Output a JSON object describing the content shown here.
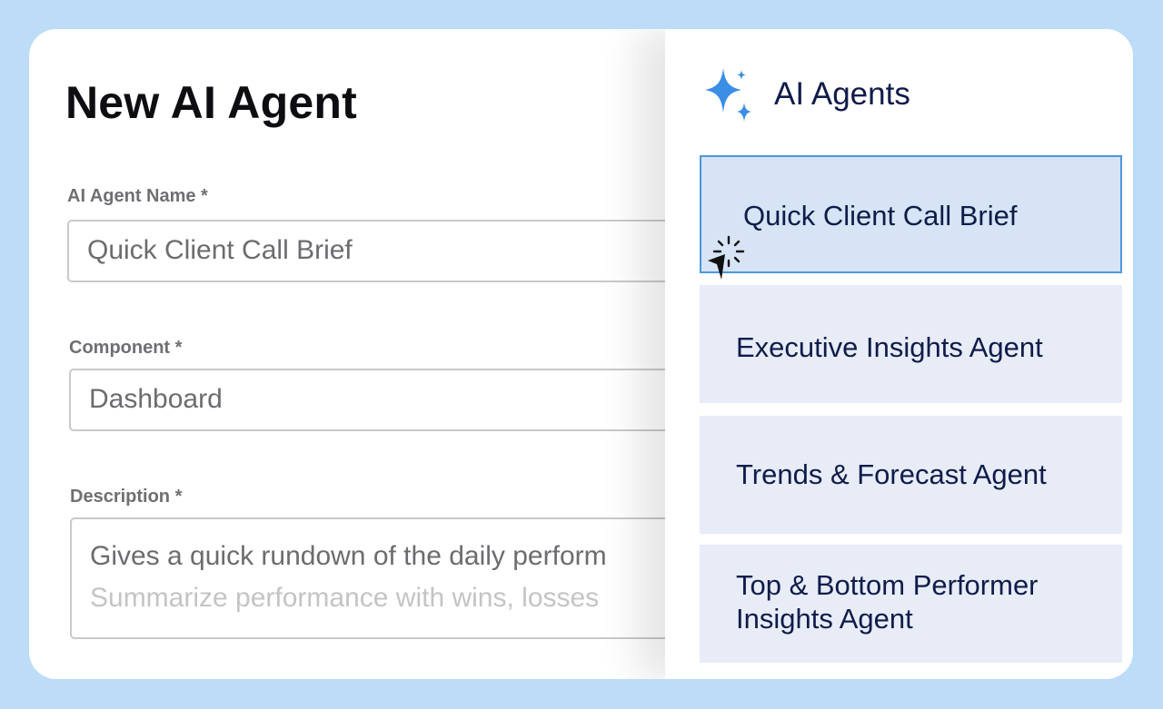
{
  "form": {
    "title": "New AI Agent",
    "fields": {
      "name": {
        "label": "AI Agent Name *",
        "value": "Quick Client Call Brief"
      },
      "component": {
        "label": "Component *",
        "value": "Dashboard"
      },
      "description": {
        "label": "Description *",
        "value_line1": "Gives a quick rundown of the daily perform",
        "value_line2": "Summarize performance with wins, losses"
      }
    }
  },
  "panel": {
    "icon": "sparkle-icon",
    "title": "AI Agents",
    "items": [
      {
        "label": "Quick Client Call Brief",
        "selected": true
      },
      {
        "label": "Executive Insights Agent",
        "selected": false
      },
      {
        "label": "Trends & Forecast Agent",
        "selected": false
      },
      {
        "label_line1": "Top & Bottom Performer",
        "label_line2": "Insights Agent",
        "selected": false
      }
    ]
  },
  "colors": {
    "background": "#bcdcf7",
    "accent": "#3a8ee6",
    "selected_border": "#4d97dd",
    "item_bg": "#e7ecf7",
    "text_dark": "#0f1c4a"
  }
}
